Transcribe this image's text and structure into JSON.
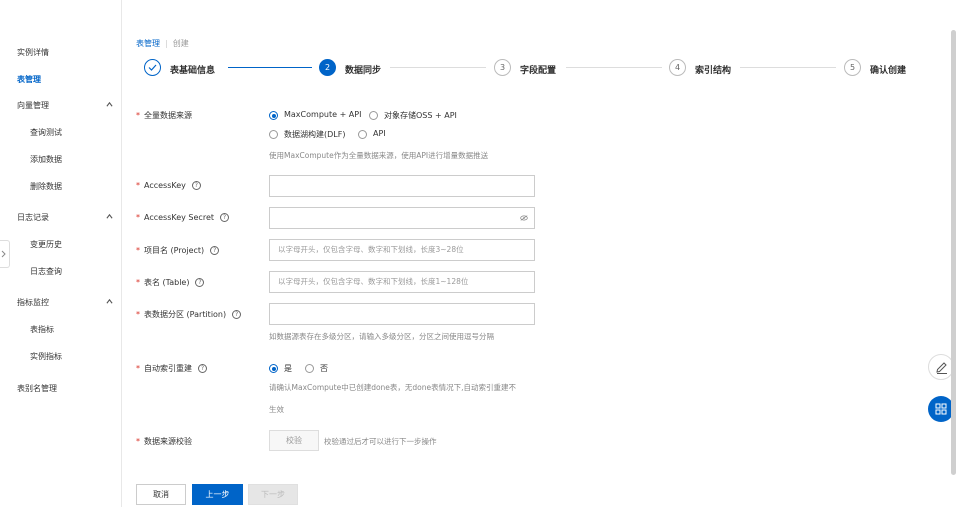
{
  "sidebar": {
    "items": [
      {
        "label": "实例详情"
      },
      {
        "label": "表管理"
      },
      {
        "label": "向量管理"
      },
      {
        "label": "查询测试"
      },
      {
        "label": "添加数据"
      },
      {
        "label": "删除数据"
      },
      {
        "label": "日志记录"
      },
      {
        "label": "变更历史"
      },
      {
        "label": "日志查询"
      },
      {
        "label": "指标监控"
      },
      {
        "label": "表指标"
      },
      {
        "label": "实例指标"
      },
      {
        "label": "表别名管理"
      }
    ]
  },
  "breadcrumb": {
    "parent": "表管理",
    "current": "创建"
  },
  "steps": [
    {
      "num": "",
      "label": "表基础信息",
      "state": "done"
    },
    {
      "num": "2",
      "label": "数据同步",
      "state": "current"
    },
    {
      "num": "3",
      "label": "字段配置",
      "state": "todo"
    },
    {
      "num": "4",
      "label": "索引结构",
      "state": "todo"
    },
    {
      "num": "5",
      "label": "确认创建",
      "state": "todo"
    }
  ],
  "form": {
    "source": {
      "label": "全量数据来源",
      "options": [
        "MaxCompute + API",
        "对象存储OSS + API",
        "数据湖构建(DLF)",
        "API"
      ],
      "selected": "MaxCompute + API",
      "hint": "使用MaxCompute作为全量数据来源，使用API进行增量数据推送"
    },
    "access_key": {
      "label": "AccessKey",
      "value": ""
    },
    "access_key_secret": {
      "label": "AccessKey Secret",
      "value": ""
    },
    "project": {
      "label": "项目名 (Project)",
      "placeholder": "以字母开头，仅包含字母、数字和下划线，长度3~28位"
    },
    "table": {
      "label": "表名 (Table)",
      "placeholder": "以字母开头，仅包含字母、数字和下划线，长度1~128位"
    },
    "partition": {
      "label": "表数据分区 (Partition)",
      "value": "",
      "hint": "如数据源表存在多级分区，请输入多级分区，分区之间使用逗号分隔"
    },
    "auto_rebuild": {
      "label": "自动索引重建",
      "options": [
        "是",
        "否"
      ],
      "selected": "是",
      "hint_line1": "请确认MaxCompute中已创建done表，无done表情况下,自动索引重建不",
      "hint_line2": "生效"
    },
    "verify": {
      "label": "数据来源校验",
      "button": "校验",
      "hint": "校验通过后才可以进行下一步操作"
    }
  },
  "footer": {
    "cancel": "取消",
    "prev": "上一步",
    "next": "下一步"
  },
  "colors": {
    "primary": "#0064c8",
    "required": "#d93026"
  }
}
